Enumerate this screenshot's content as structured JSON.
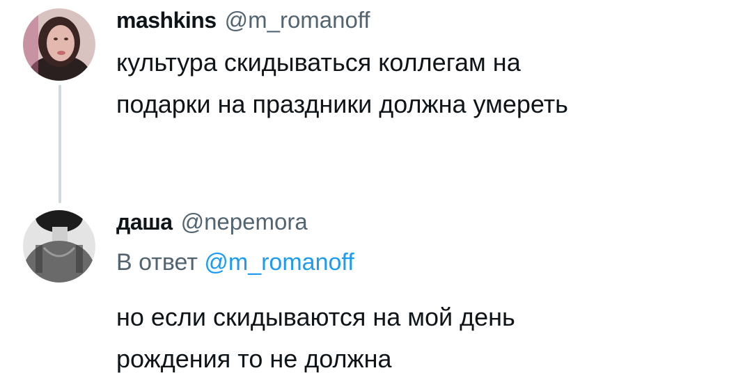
{
  "tweets": [
    {
      "author_name": "mashkins",
      "author_handle": "@m_romanoff",
      "text_lines": [
        "культура скидываться коллегам на",
        "подарки на праздники должна умереть"
      ]
    },
    {
      "author_name": "даша",
      "author_handle": "@nepemora",
      "reply_prefix": "В ответ",
      "reply_to": "@m_romanoff",
      "text_lines": [
        "но если скидываются на мой день",
        "рождения то не должна"
      ]
    }
  ],
  "colors": {
    "text": "#0f1419",
    "secondary": "#536471",
    "link": "#1d9bf0",
    "thread_line": "#cfd9de"
  }
}
